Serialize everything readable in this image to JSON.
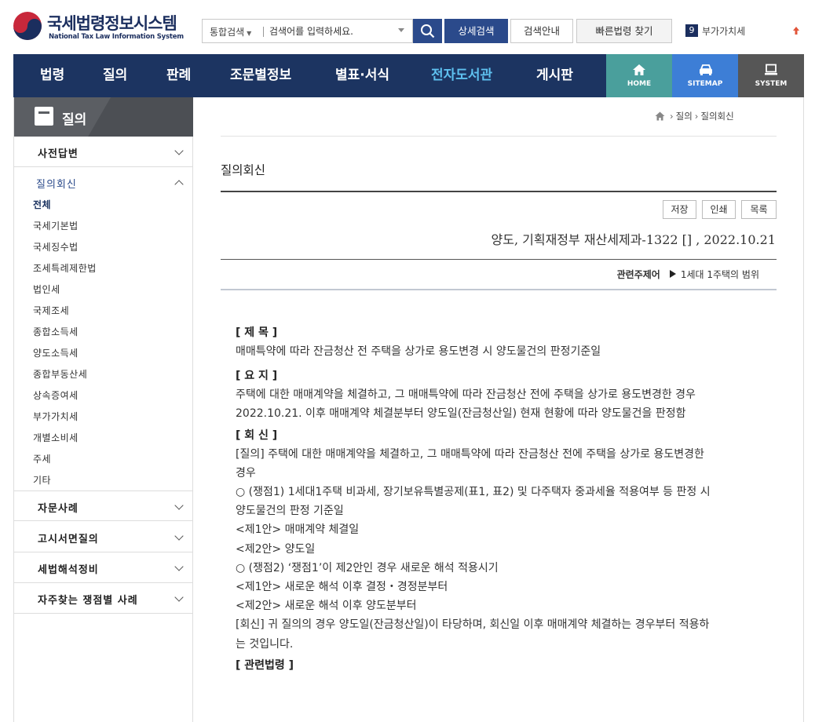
{
  "header": {
    "logo_title": "국세법령정보시스템",
    "logo_subtitle": "National Tax Law Information System",
    "search_scope": "통합검색",
    "search_placeholder": "검색어를 입력하세요.",
    "advanced_search": "상세검색",
    "search_guide": "검색안내",
    "quick_law": "빠른법령 찾기",
    "rank_number": "9",
    "rank_keyword": "부가가치세"
  },
  "nav": {
    "items": [
      "법령",
      "질의",
      "판례",
      "조문별정보",
      "별표·서식",
      "전자도서관",
      "게시판"
    ],
    "active": "전자도서관",
    "quick": {
      "home": "HOME",
      "sitemap": "SITEMAP",
      "system": "SYSTEM"
    }
  },
  "sidebar": {
    "title": "질의",
    "groups": [
      "사전답변",
      "질의회신",
      "자문사례",
      "고시서면질의",
      "세법해석정비",
      "자주찾는 쟁점별 사례"
    ],
    "sub_items": [
      "전체",
      "국세기본법",
      "국세징수법",
      "조세특례제한법",
      "법인세",
      "국제조세",
      "종합소득세",
      "양도소득세",
      "종합부동산세",
      "상속증여세",
      "부가가치세",
      "개별소비세",
      "주세",
      "기타"
    ]
  },
  "breadcrumb": {
    "level1": "질의",
    "level2": "질의회신"
  },
  "page": {
    "title": "질의회신",
    "buttons": {
      "save": "저장",
      "print": "인쇄",
      "list": "목록"
    },
    "doc_header": "양도, 기획재정부 재산세제과-1322 [] , 2022.10.21",
    "keyword_label": "관련주제어",
    "keyword_value": "1세대 1주택의 범위"
  },
  "doc": {
    "subject_h": "[ 제 목 ]",
    "subject": "매매특약에 따라 잔금청산 전 주택을 상가로 용도변경 시 양도물건의 판정기준일",
    "summary_h": "[ 요 지 ]",
    "summary_1": "주택에 대한 매매계약을 체결하고, 그 매매특약에 따라 잔금청산 전에 주택을 상가로 용도변경한 경우",
    "summary_2": "2022.10.21. 이후 매매계약 체결분부터 양도일(잔금청산일) 현재 현황에 따라 양도물건을 판정함",
    "reply_h": "[ 회 신 ]",
    "reply_1": "[질의] 주택에 대한 매매계약을 체결하고, 그 매매특약에 따라 잔금청산 전에 주택을 상가로 용도변경한",
    "reply_2": "경우",
    "reply_3": "○ (쟁점1) 1세대1주택 비과세, 장기보유특별공제(표1, 표2) 및 다주택자 중과세율 적용여부 등 판정 시",
    "reply_4": "양도물건의 판정 기준일",
    "reply_5": "<제1안> 매매계약 체결일",
    "reply_6": "<제2안> 양도일",
    "reply_7": "○ (쟁점2) ‘쟁점1’이 제2안인 경우 새로운 해석 적용시기",
    "reply_8": "<제1안> 새로운 해석 이후 결정・경정분부터",
    "reply_9": "<제2안> 새로운 해석 이후 양도분부터",
    "reply_10": "[회신] 귀 질의의 경우 양도일(잔금청산일)이 타당하며, 회신일 이후 매매계약 체결하는 경우부터 적용하",
    "reply_11": "는 것입니다.",
    "law_h": "[ 관련법령 ]"
  }
}
